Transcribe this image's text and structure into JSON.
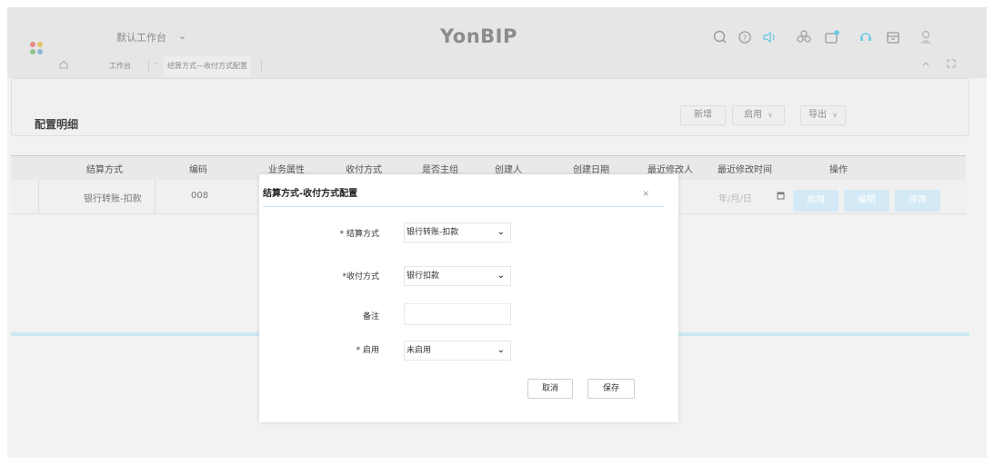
{
  "header": {
    "workspace_title": "默认工作台",
    "workspace_chevron": "⌄",
    "brand": "YonBIP",
    "icons": [
      "search-icon",
      "help-icon",
      "notification-sound-icon",
      "apps-icon",
      "message-icon",
      "service-icon",
      "calendar-icon",
      "avatar-icon"
    ]
  },
  "tabs": {
    "home_tab": "工作台",
    "active_tab": "结算方式—收付方式配置"
  },
  "page": {
    "title": "配置明细",
    "buttons": {
      "add": "新增",
      "enable": "启用",
      "export": "导出"
    }
  },
  "table": {
    "headers": [
      "结算方式",
      "编码",
      "业务属性",
      "收付方式",
      "是否主组",
      "创建人",
      "创建日期",
      "最近修改人",
      "最近修改时间",
      "操作"
    ],
    "row": {
      "settle_method": "银行转账-扣款",
      "code": "008",
      "date_placeholder": "年/月/日",
      "actions": [
        "启用",
        "编辑",
        "停用"
      ]
    }
  },
  "modal": {
    "title": "结算方式-收付方式配置",
    "close": "×",
    "fields": {
      "settle_label": "* 结算方式",
      "settle_value": "银行转账-扣款",
      "pay_label": "*收付方式",
      "pay_value": "银行扣款",
      "remark_label": "备注",
      "enable_label": "* 启用",
      "enable_value": "未启用"
    },
    "cancel": "取消",
    "save": "保存"
  },
  "colors": {
    "accent": "#c8e9ef",
    "action_button": "#d3e9f6",
    "brand_text": "#8c8c8c"
  }
}
